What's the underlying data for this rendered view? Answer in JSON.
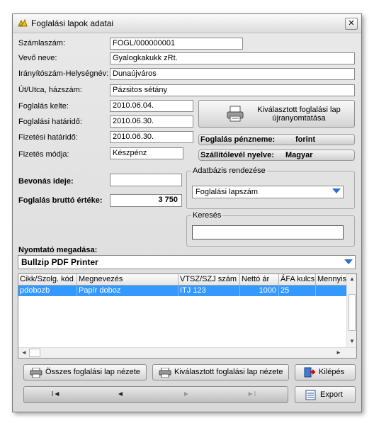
{
  "window": {
    "title": "Foglalási lapok adatai"
  },
  "fields": {
    "szamlaszam": {
      "label": "Számlaszám:",
      "value": "FOGL/000000001"
    },
    "vevo_neve": {
      "label": "Vevő neve:",
      "value": "Gyalogkakukk zRt."
    },
    "iranyitoszam": {
      "label": "Irányítószám-Helységnév:",
      "value": "Dunaújváros"
    },
    "utca": {
      "label": "Út/Utca, házszám:",
      "value": "Pázsitos sétány"
    },
    "foglalas_kelte": {
      "label": "Foglalás kelte:",
      "value": "2010.06.04."
    },
    "foglalasi_hatarido": {
      "label": "Foglalási határidő:",
      "value": "2010.06.30."
    },
    "fizetesi_hatarido": {
      "label": "Fizetési határidő:",
      "value": "2010.06.30."
    },
    "fizetes_modja": {
      "label": "Fizetés módja:",
      "value": "Készpénz"
    },
    "bevonas_ideje": {
      "label": "Bevonás ideje:",
      "value": ""
    },
    "brutto_ertek": {
      "label": "Foglalás bruttó értéke:",
      "value": "3 750"
    }
  },
  "reprint": {
    "line1": "Kiválasztott foglalási lap",
    "line2": "újranyomtatása"
  },
  "currency": {
    "label": "Foglalás pénzneme:",
    "value": "forint"
  },
  "language": {
    "label": "Szállítólevél nyelve:",
    "value": "Magyar"
  },
  "db_sort": {
    "legend": "Adatbázis rendezése",
    "selected": "Foglalási lapszám"
  },
  "search": {
    "legend": "Keresés",
    "value": ""
  },
  "printer": {
    "label": "Nyomtató megadása:",
    "selected": "Bullzip PDF Printer"
  },
  "table": {
    "columns": [
      "Cikk/Szolg. kód",
      "Megnevezés",
      "VTSZ/SZJ szám",
      "Nettó ár",
      "ÁFA kulcs",
      "Mennyis"
    ],
    "rows": [
      [
        "pdobozb",
        "Papír doboz",
        "ITJ 123",
        "1000",
        "25",
        ""
      ]
    ]
  },
  "buttons": {
    "all_view": "Összes foglalási lap nézete",
    "selected_view": "Kiválasztott foglalási lap nézete",
    "exit": "Kilépés",
    "export": "Export"
  },
  "nav": {
    "first": "I◄",
    "prev": "◄",
    "next": "►",
    "last": "►I"
  },
  "colors": {
    "selection": "#3399ff",
    "combo_arrow": "#2a6fd1"
  }
}
